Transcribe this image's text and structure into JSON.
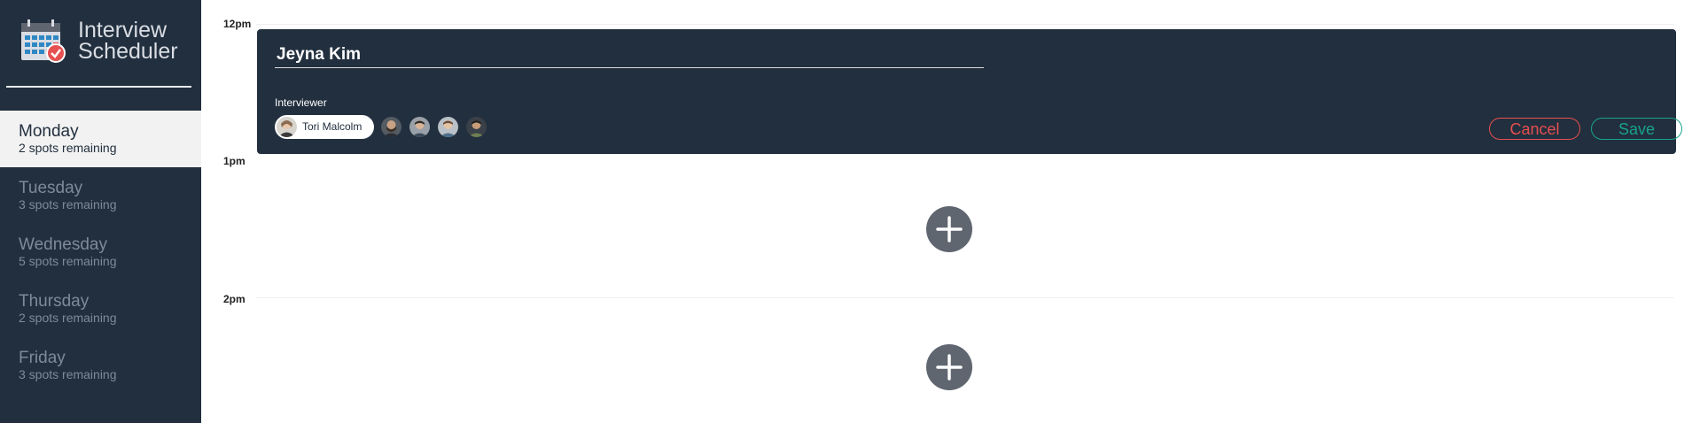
{
  "brand": {
    "title_line1": "Interview",
    "title_line2": "Scheduler",
    "logo_icon": "calendar-check-icon"
  },
  "days": [
    {
      "name": "Monday",
      "spots": "2 spots remaining",
      "selected": true
    },
    {
      "name": "Tuesday",
      "spots": "3 spots remaining",
      "selected": false
    },
    {
      "name": "Wednesday",
      "spots": "5 spots remaining",
      "selected": false
    },
    {
      "name": "Thursday",
      "spots": "2 spots remaining",
      "selected": false
    },
    {
      "name": "Friday",
      "spots": "3 spots remaining",
      "selected": false
    }
  ],
  "times": [
    "12pm",
    "1pm",
    "2pm"
  ],
  "form": {
    "student_name": "Jeyna Kim",
    "interviewer_heading": "Interviewer",
    "selected_interviewer": "Tori Malcolm",
    "cancel_label": "Cancel",
    "save_label": "Save"
  },
  "colors": {
    "sidebar": "#222f3e",
    "cancel": "#e65050",
    "save": "#18a38a",
    "add_button": "#5f6670"
  }
}
